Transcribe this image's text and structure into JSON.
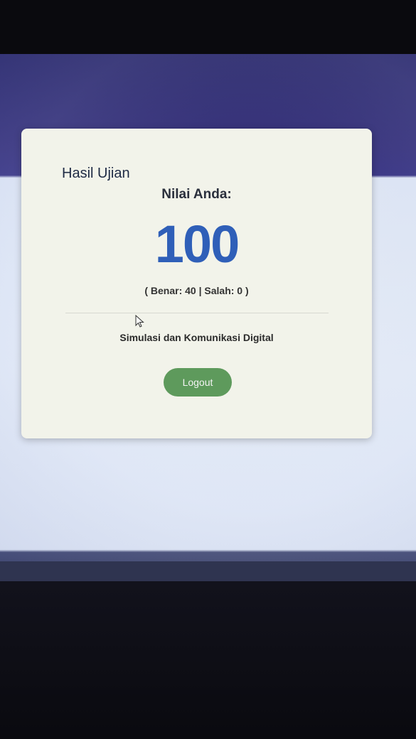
{
  "result": {
    "title": "Hasil Ujian",
    "score_label": "Nilai Anda:",
    "score_value": "100",
    "score_detail": "( Benar: 40 | Salah: 0 )",
    "subject": "Simulasi dan Komunikasi Digital",
    "logout_label": "Logout"
  },
  "colors": {
    "score": "#2f5fb8",
    "logout_button": "#5e9a5c",
    "page_header": "#2a2370"
  },
  "icons": [
    "mouse-cursor-icon"
  ]
}
